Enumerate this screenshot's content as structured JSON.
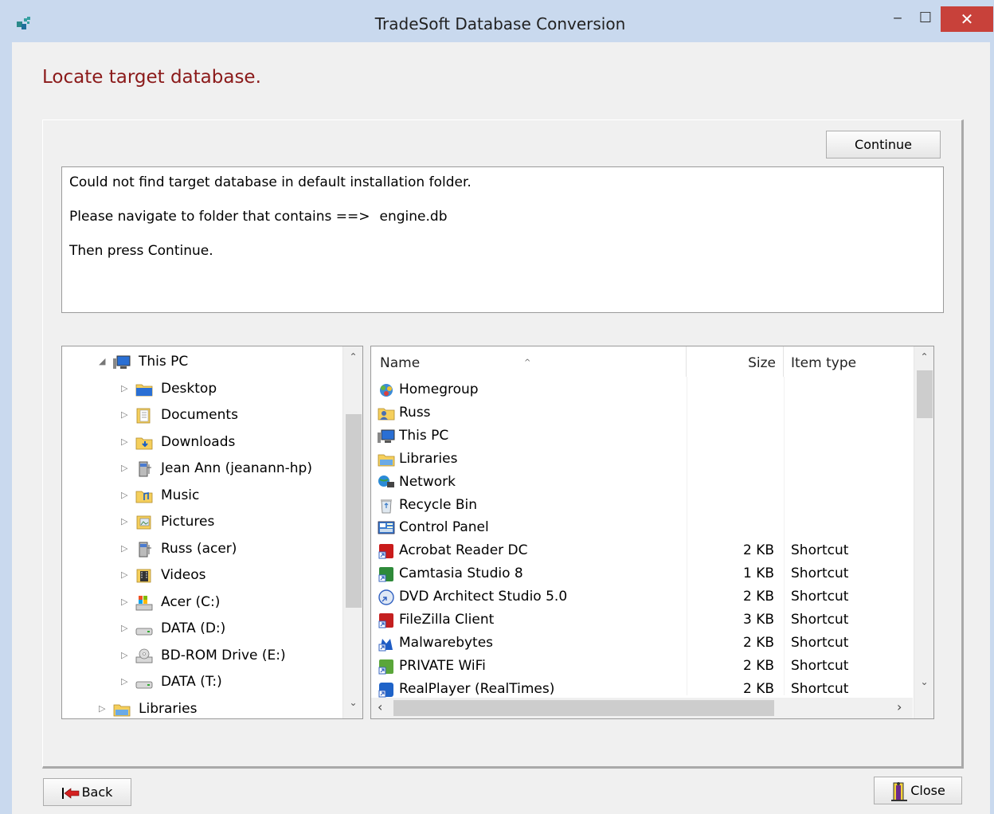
{
  "window": {
    "title": "TradeSoft Database Conversion",
    "minimize_glyph": "‒",
    "maximize_glyph": "☐",
    "close_glyph": "✕"
  },
  "page": {
    "heading": "Locate target database.",
    "continue_label": "Continue",
    "message": {
      "line1": "Could not find target database in default installation folder.",
      "line2": "Please navigate to folder that contains ==>",
      "filename": "engine.db",
      "line3": "Then press Continue."
    },
    "back_label": "Back",
    "close_label": "Close"
  },
  "tree": {
    "items": [
      {
        "label": "This PC",
        "icon": "computer-icon",
        "expanded": true
      },
      {
        "label": "Desktop",
        "icon": "desktop-folder-icon"
      },
      {
        "label": "Documents",
        "icon": "documents-folder-icon"
      },
      {
        "label": "Downloads",
        "icon": "downloads-folder-icon"
      },
      {
        "label": "Jean Ann (jeanann-hp)",
        "icon": "network-user-icon"
      },
      {
        "label": "Music",
        "icon": "music-folder-icon"
      },
      {
        "label": "Pictures",
        "icon": "pictures-folder-icon"
      },
      {
        "label": "Russ (acer)",
        "icon": "network-user-icon"
      },
      {
        "label": "Videos",
        "icon": "videos-folder-icon"
      },
      {
        "label": "Acer (C:)",
        "icon": "system-drive-icon"
      },
      {
        "label": "DATA (D:)",
        "icon": "drive-icon"
      },
      {
        "label": "BD-ROM Drive (E:)",
        "icon": "optical-drive-icon"
      },
      {
        "label": "DATA (T:)",
        "icon": "drive-icon"
      },
      {
        "label": "Libraries",
        "icon": "libraries-icon"
      }
    ],
    "scroll_up": "⌃",
    "scroll_down": "⌄"
  },
  "list": {
    "columns": {
      "name": "Name",
      "size": "Size",
      "type": "Item type"
    },
    "sort_glyph": "^",
    "rows": [
      {
        "name": "Homegroup",
        "size": "",
        "type": "",
        "icon": "homegroup-icon"
      },
      {
        "name": "Russ",
        "size": "",
        "type": "",
        "icon": "user-folder-icon"
      },
      {
        "name": "This PC",
        "size": "",
        "type": "",
        "icon": "computer-icon"
      },
      {
        "name": "Libraries",
        "size": "",
        "type": "",
        "icon": "libraries-icon"
      },
      {
        "name": "Network",
        "size": "",
        "type": "",
        "icon": "network-icon"
      },
      {
        "name": "Recycle Bin",
        "size": "",
        "type": "",
        "icon": "recycle-bin-icon"
      },
      {
        "name": "Control Panel",
        "size": "",
        "type": "",
        "icon": "control-panel-icon"
      },
      {
        "name": "Acrobat Reader DC",
        "size": "2 KB",
        "type": "Shortcut",
        "icon": "acrobat-shortcut-icon"
      },
      {
        "name": "Camtasia Studio 8",
        "size": "1 KB",
        "type": "Shortcut",
        "icon": "camtasia-shortcut-icon"
      },
      {
        "name": "DVD Architect Studio 5.0",
        "size": "2 KB",
        "type": "Shortcut",
        "icon": "dvd-architect-shortcut-icon"
      },
      {
        "name": "FileZilla Client",
        "size": "3 KB",
        "type": "Shortcut",
        "icon": "filezilla-shortcut-icon"
      },
      {
        "name": "Malwarebytes",
        "size": "2 KB",
        "type": "Shortcut",
        "icon": "malwarebytes-shortcut-icon"
      },
      {
        "name": "PRIVATE WiFi",
        "size": "2 KB",
        "type": "Shortcut",
        "icon": "private-wifi-shortcut-icon"
      },
      {
        "name": "RealPlayer (RealTimes)",
        "size": "2 KB",
        "type": "Shortcut",
        "icon": "realplayer-shortcut-icon"
      }
    ],
    "scroll_left": "‹",
    "scroll_right": "›"
  },
  "colors": {
    "heading": "#8b1a1a",
    "titlebar": "#c9d9ee",
    "close_button": "#c8413a"
  }
}
